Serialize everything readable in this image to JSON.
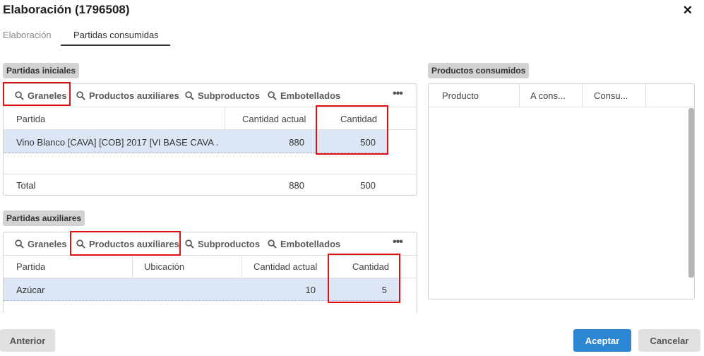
{
  "dialog": {
    "title": "Elaboración (1796508)"
  },
  "tabs": [
    {
      "label": "Elaboración"
    },
    {
      "label": "Partidas consumidas"
    }
  ],
  "partidas_iniciales": {
    "label": "Partidas iniciales",
    "toolbar": [
      "Graneles",
      "Productos auxiliares",
      "Subproductos",
      "Embotellados"
    ],
    "columns": [
      "Partida",
      "Cantidad actual",
      "Cantidad"
    ],
    "rows": [
      {
        "partida": "Vino Blanco [CAVA] [COB] 2017 [VI BASE CAVA ...",
        "cantidad_actual": "880",
        "cantidad": "500"
      }
    ],
    "total": {
      "label": "Total",
      "cantidad_actual": "880",
      "cantidad": "500"
    }
  },
  "partidas_auxiliares": {
    "label": "Partidas auxiliares",
    "toolbar": [
      "Graneles",
      "Productos auxiliares",
      "Subproductos",
      "Embotellados"
    ],
    "columns": [
      "Partida",
      "Ubicación",
      "Cantidad actual",
      "Cantidad"
    ],
    "rows": [
      {
        "partida": "Azúcar",
        "ubicacion": "",
        "cantidad_actual": "10",
        "cantidad": "5"
      }
    ]
  },
  "productos_consumidos": {
    "label": "Productos consumidos",
    "columns": [
      "Producto",
      "A cons...",
      "Consu..."
    ]
  },
  "footer": {
    "anterior": "Anterior",
    "aceptar": "Aceptar",
    "cancelar": "Cancelar"
  },
  "colors": {
    "accent": "#2d86d1",
    "selection": "#dde6f5",
    "highlight": "#e01010"
  }
}
